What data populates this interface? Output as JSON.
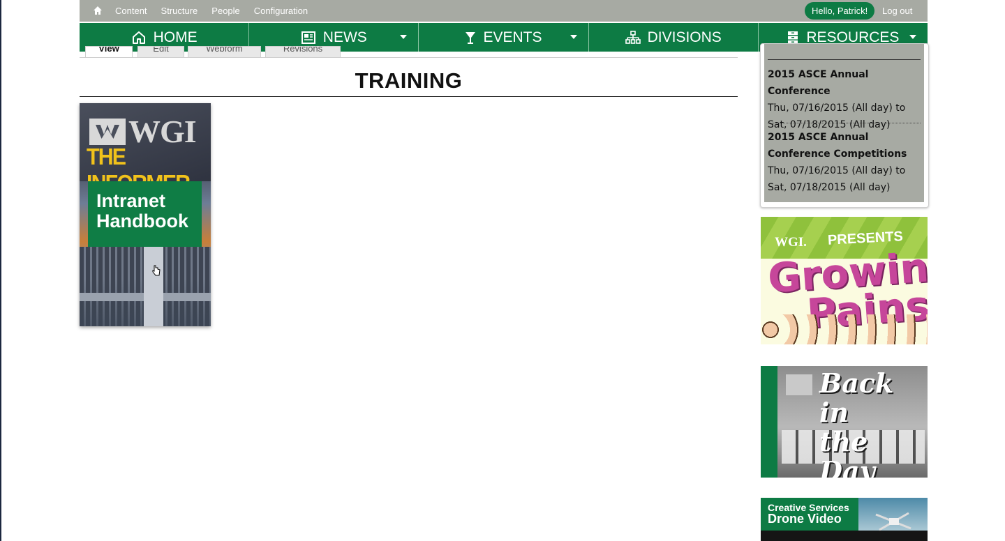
{
  "admin_bar": {
    "links": [
      "Content",
      "Structure",
      "People",
      "Configuration"
    ],
    "user_greeting": "Hello, Patrick!",
    "logout": "Log out"
  },
  "main_nav": {
    "items": [
      {
        "label": "HOME",
        "icon": "home-icon",
        "has_dropdown": false
      },
      {
        "label": "NEWS",
        "icon": "newspaper-icon",
        "has_dropdown": true
      },
      {
        "label": "EVENTS",
        "icon": "glass-icon",
        "has_dropdown": true
      },
      {
        "label": "DIVISIONS",
        "icon": "sitemap-icon",
        "has_dropdown": false
      },
      {
        "label": "RESOURCES",
        "icon": "archive-icon",
        "has_dropdown": true
      }
    ]
  },
  "tabs": [
    "View",
    "Edit",
    "Webform",
    "Revisions"
  ],
  "page": {
    "title": "TRAINING"
  },
  "handbook": {
    "brand": "WGI",
    "masthead": "THE INFORMER",
    "title_line1": "Intranet",
    "title_line2": "Handbook"
  },
  "events": [
    {
      "title": "2015 ASCE Annual Conference",
      "dates": "Thu, 07/16/2015 (All day) to Sat, 07/18/2015 (All day)"
    },
    {
      "title": "2015 ASCE Annual Conference Competitions",
      "dates": "Thu, 07/16/2015 (All day) to Sat, 07/18/2015 (All day)"
    }
  ],
  "promos": {
    "growing_pains": {
      "brand": "WGI.",
      "presents": "PRESENTS",
      "word1": "Growing",
      "word2": "Pains"
    },
    "back_in_the_day": {
      "line1": "Back in",
      "line2": "the Day"
    },
    "drone": {
      "line1": "Creative Services",
      "line2": "Drone Video"
    }
  },
  "colors": {
    "brand_green": "#0d7b44",
    "admin_gray": "#a7aaa3",
    "sidebar_gray": "#a7aaa3"
  }
}
